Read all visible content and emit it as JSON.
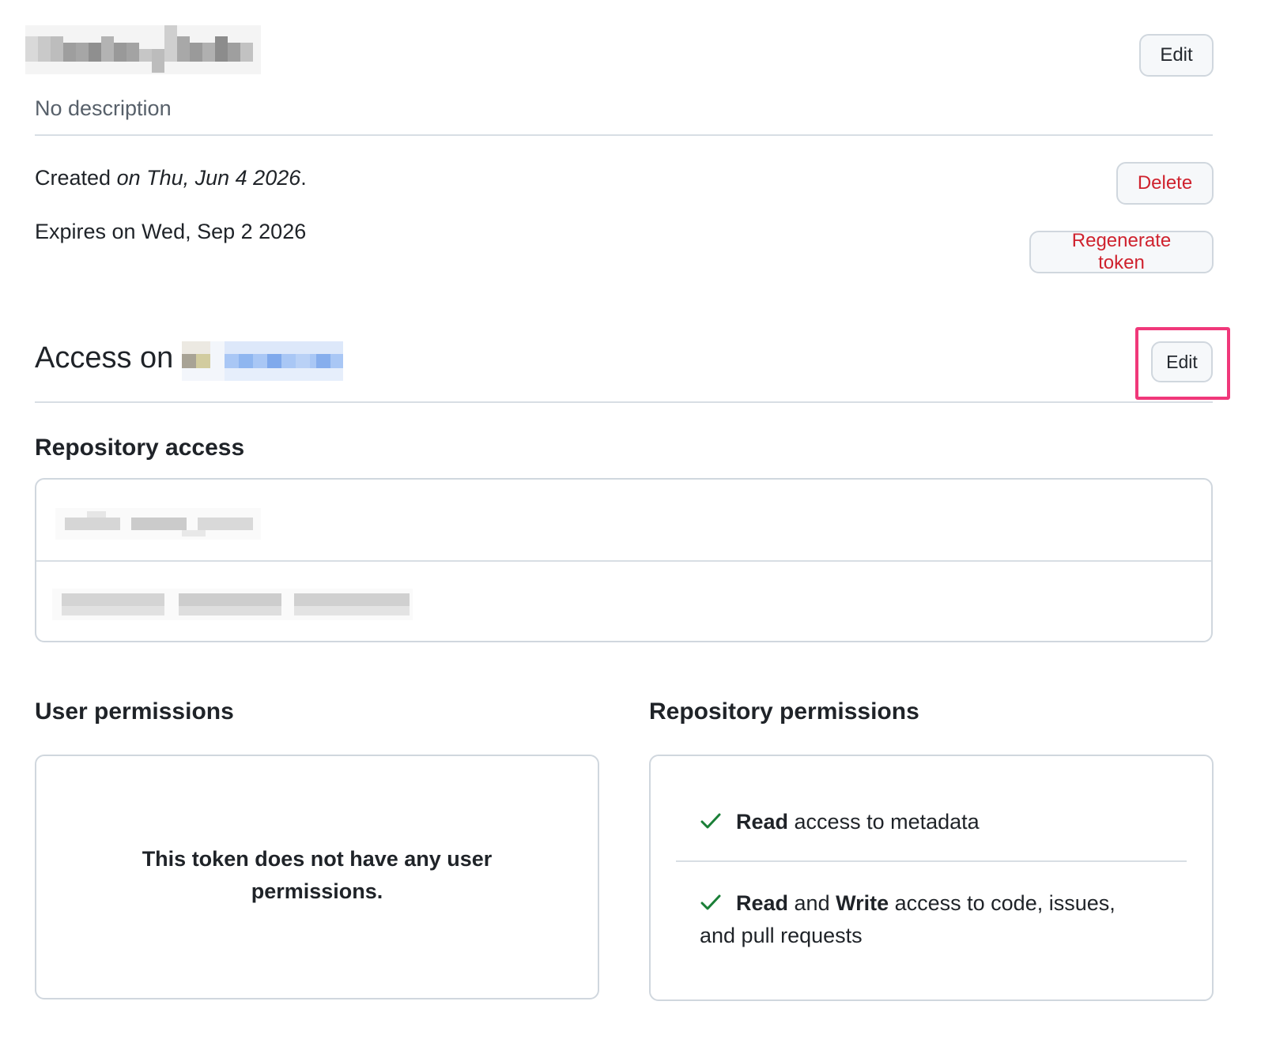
{
  "token": {
    "description": "No description",
    "created_prefix": "Created ",
    "created_date": "on Thu, Jun 4 2026",
    "created_suffix": ".",
    "expires": "Expires on Wed, Sep 2 2026"
  },
  "header_buttons": {
    "edit_label": "Edit",
    "delete_label": "Delete",
    "regenerate_label": "Regenerate token"
  },
  "access": {
    "heading_prefix": "Access on",
    "edit_label": "Edit"
  },
  "repository_access": {
    "title": "Repository access"
  },
  "user_permissions": {
    "title": "User permissions",
    "empty_message": "This token does not have any user permissions."
  },
  "repository_permissions": {
    "title": "Repository permissions",
    "items": [
      {
        "strong1": "Read",
        "text1": " access to metadata"
      },
      {
        "strong1": "Read",
        "text1": " and ",
        "strong2": "Write",
        "text2": " access to code, issues, and pull requests"
      }
    ]
  },
  "colors": {
    "danger": "#cf222e",
    "success": "#1a7f37",
    "highlight": "#f0387a",
    "border": "#d0d7de"
  },
  "icons": {
    "check": "check-icon"
  }
}
